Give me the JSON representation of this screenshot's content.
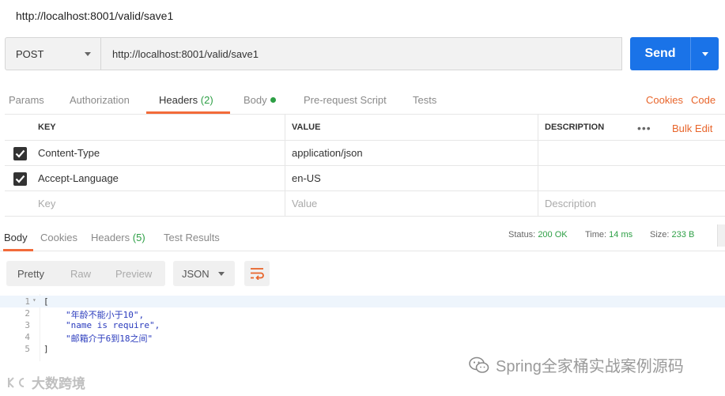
{
  "title": "http://localhost:8001/valid/save1",
  "request": {
    "method": "POST",
    "url": "http://localhost:8001/valid/save1",
    "send_label": "Send"
  },
  "request_tabs": {
    "params": "Params",
    "authorization": "Authorization",
    "headers": "Headers",
    "headers_count": "(2)",
    "body": "Body",
    "pre_request": "Pre-request Script",
    "tests": "Tests",
    "cookies": "Cookies",
    "code": "Code"
  },
  "headers_table": {
    "col_key": "KEY",
    "col_value": "VALUE",
    "col_description": "DESCRIPTION",
    "more": "•••",
    "bulk_edit": "Bulk Edit",
    "rows": [
      {
        "key": "Content-Type",
        "value": "application/json",
        "checked": true
      },
      {
        "key": "Accept-Language",
        "value": "en-US",
        "checked": true
      }
    ],
    "placeholder_key": "Key",
    "placeholder_value": "Value",
    "placeholder_description": "Description"
  },
  "response_tabs": {
    "body": "Body",
    "cookies": "Cookies",
    "headers": "Headers",
    "headers_count": "(5)",
    "test_results": "Test Results"
  },
  "status": {
    "status_label": "Status:",
    "status_value": "200 OK",
    "time_label": "Time:",
    "time_value": "14 ms",
    "size_label": "Size:",
    "size_value": "233 B"
  },
  "view": {
    "pretty": "Pretty",
    "raw": "Raw",
    "preview": "Preview",
    "format": "JSON"
  },
  "response_body": {
    "lines": [
      {
        "num": "1",
        "open": "["
      },
      {
        "num": "2",
        "text": "\"年龄不能小于10\","
      },
      {
        "num": "3",
        "text": "\"name is require\","
      },
      {
        "num": "4",
        "text": "\"邮箱介于6到18之间\""
      },
      {
        "num": "5",
        "close": "]"
      }
    ]
  },
  "watermarks": {
    "left": "大数跨境",
    "right": "Spring全家桶实战案例源码"
  },
  "colors": {
    "accent": "#f26b3a",
    "send": "#1a73e8",
    "ok_green": "#2d9f45",
    "link_orange": "#e8652b"
  }
}
